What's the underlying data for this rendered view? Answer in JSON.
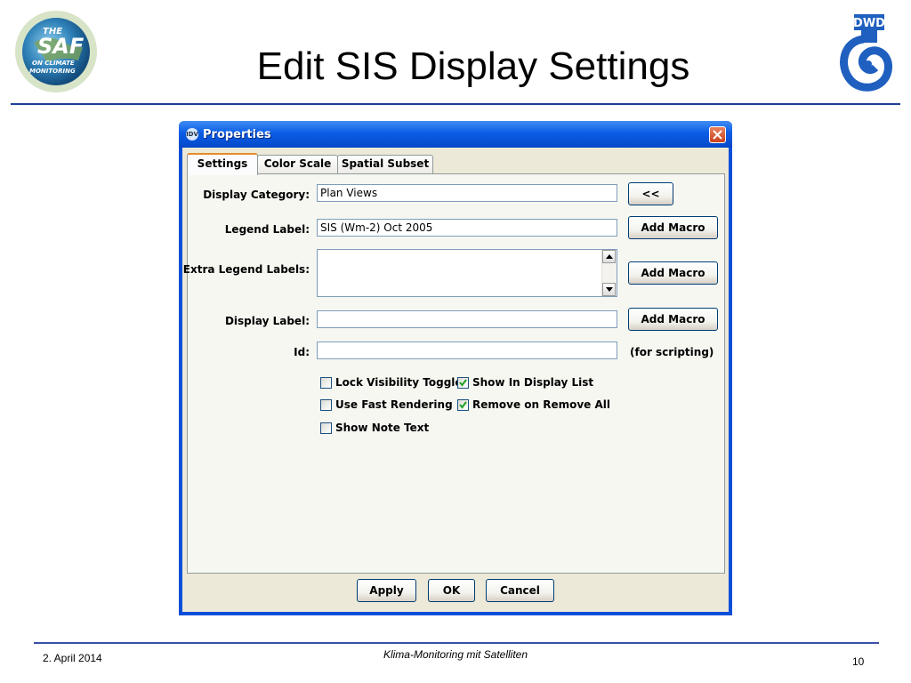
{
  "slide": {
    "title": "Edit SIS Display Settings",
    "footer_date": "2. April 2014",
    "footer_center": "Klima-Monitoring mit Satelliten",
    "page_number": "10",
    "dwd_logo_text": "DWD",
    "saf_logo_text": "THE SAF ON CLIMATE MONITORING",
    "accent_color": "#1f3f98"
  },
  "dialog": {
    "title": "Properties",
    "title_icon": "idv-icon",
    "tabs": [
      {
        "label": "Settings",
        "active": true
      },
      {
        "label": "Color Scale",
        "active": false
      },
      {
        "label": "Spatial Subset",
        "active": false
      }
    ],
    "fields": {
      "display_category": {
        "label": "Display Category:",
        "value": "Plan Views",
        "button": "<<"
      },
      "legend_label": {
        "label": "Legend Label:",
        "value": "SIS (Wm-2) Oct 2005",
        "button": "Add Macro"
      },
      "extra_legend_labels": {
        "label": "Extra Legend Labels:",
        "value": "",
        "button": "Add Macro"
      },
      "display_label": {
        "label": "Display Label:",
        "value": "",
        "button": "Add Macro"
      },
      "id": {
        "label": "Id:",
        "value": "",
        "note": "(for scripting)"
      }
    },
    "checkboxes": [
      {
        "label": "Lock Visibility Toggle",
        "checked": false
      },
      {
        "label": "Show In Display List",
        "checked": true
      },
      {
        "label": "Use Fast Rendering",
        "checked": false
      },
      {
        "label": "Remove on Remove All",
        "checked": true
      },
      {
        "label": "Show Note Text",
        "checked": false
      }
    ],
    "buttons": {
      "apply": "Apply",
      "ok": "OK",
      "cancel": "Cancel"
    }
  }
}
